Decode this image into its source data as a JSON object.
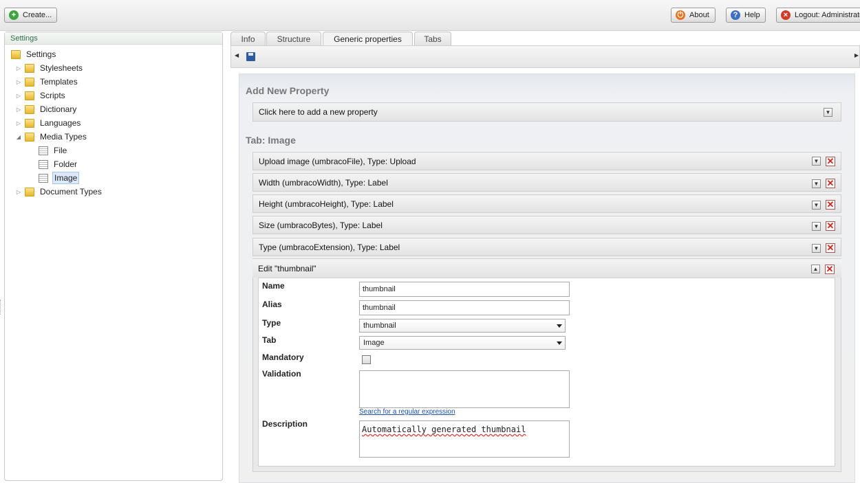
{
  "topbar": {
    "create_label": "Create...",
    "about_label": "About",
    "help_label": "Help",
    "logout_label": "Logout: Administrator"
  },
  "sidebar": {
    "header": "Settings",
    "root": "Settings",
    "items": [
      {
        "label": "Stylesheets"
      },
      {
        "label": "Templates"
      },
      {
        "label": "Scripts"
      },
      {
        "label": "Dictionary"
      },
      {
        "label": "Languages"
      },
      {
        "label": "Media Types"
      },
      {
        "label": "File"
      },
      {
        "label": "Folder"
      },
      {
        "label": "Image"
      },
      {
        "label": "Document Types"
      }
    ]
  },
  "tabs": [
    {
      "label": "Info"
    },
    {
      "label": "Structure"
    },
    {
      "label": "Generic properties"
    },
    {
      "label": "Tabs"
    }
  ],
  "main": {
    "add_title": "Add New Property",
    "add_row": "Click here to add a new property",
    "tab_title": "Tab: Image",
    "properties": [
      {
        "label": "Upload image (umbracoFile), Type: Upload"
      },
      {
        "label": "Width (umbracoWidth), Type: Label"
      },
      {
        "label": "Height (umbracoHeight), Type: Label"
      },
      {
        "label": "Size (umbracoBytes), Type: Label"
      },
      {
        "label": "Type (umbracoExtension), Type: Label"
      }
    ],
    "edit": {
      "title": "Edit \"thumbnail\"",
      "name_label": "Name",
      "name_value": "thumbnail",
      "alias_label": "Alias",
      "alias_value": "thumbnail",
      "type_label": "Type",
      "type_value": "thumbnail",
      "tab_label": "Tab",
      "tab_value": "Image",
      "mandatory_label": "Mandatory",
      "validation_label": "Validation",
      "regex_link": "Search for a regular expression",
      "description_label": "Description",
      "description_value": "Automatically generated thumbnail"
    }
  }
}
